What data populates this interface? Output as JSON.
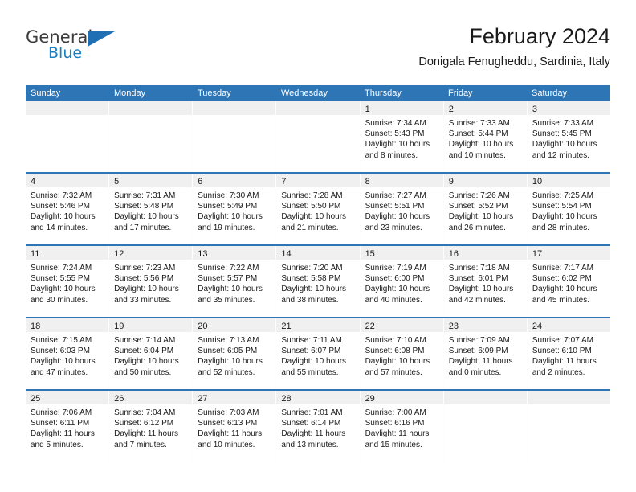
{
  "brand": {
    "name_top": "General",
    "name_bottom": "Blue",
    "flag_icon": "triangle-flag-icon",
    "color_blue": "#1a80c4",
    "color_flag": "#1f6fb4"
  },
  "header": {
    "title": "February 2024",
    "subtitle": "Donigala Fenugheddu, Sardinia, Italy"
  },
  "calendar": {
    "accent_color": "#2e75b6",
    "dateband_color": "#f0f0f0",
    "day_headers": [
      "Sunday",
      "Monday",
      "Tuesday",
      "Wednesday",
      "Thursday",
      "Friday",
      "Saturday"
    ],
    "weeks": [
      [
        {
          "date": "",
          "empty": true,
          "lines": []
        },
        {
          "date": "",
          "empty": true,
          "lines": []
        },
        {
          "date": "",
          "empty": true,
          "lines": []
        },
        {
          "date": "",
          "empty": true,
          "lines": []
        },
        {
          "date": "1",
          "empty": false,
          "lines": [
            "Sunrise: 7:34 AM",
            "Sunset: 5:43 PM",
            "Daylight: 10 hours and 8 minutes."
          ]
        },
        {
          "date": "2",
          "empty": false,
          "lines": [
            "Sunrise: 7:33 AM",
            "Sunset: 5:44 PM",
            "Daylight: 10 hours and 10 minutes."
          ]
        },
        {
          "date": "3",
          "empty": false,
          "lines": [
            "Sunrise: 7:33 AM",
            "Sunset: 5:45 PM",
            "Daylight: 10 hours and 12 minutes."
          ]
        }
      ],
      [
        {
          "date": "4",
          "empty": false,
          "lines": [
            "Sunrise: 7:32 AM",
            "Sunset: 5:46 PM",
            "Daylight: 10 hours and 14 minutes."
          ]
        },
        {
          "date": "5",
          "empty": false,
          "lines": [
            "Sunrise: 7:31 AM",
            "Sunset: 5:48 PM",
            "Daylight: 10 hours and 17 minutes."
          ]
        },
        {
          "date": "6",
          "empty": false,
          "lines": [
            "Sunrise: 7:30 AM",
            "Sunset: 5:49 PM",
            "Daylight: 10 hours and 19 minutes."
          ]
        },
        {
          "date": "7",
          "empty": false,
          "lines": [
            "Sunrise: 7:28 AM",
            "Sunset: 5:50 PM",
            "Daylight: 10 hours and 21 minutes."
          ]
        },
        {
          "date": "8",
          "empty": false,
          "lines": [
            "Sunrise: 7:27 AM",
            "Sunset: 5:51 PM",
            "Daylight: 10 hours and 23 minutes."
          ]
        },
        {
          "date": "9",
          "empty": false,
          "lines": [
            "Sunrise: 7:26 AM",
            "Sunset: 5:52 PM",
            "Daylight: 10 hours and 26 minutes."
          ]
        },
        {
          "date": "10",
          "empty": false,
          "lines": [
            "Sunrise: 7:25 AM",
            "Sunset: 5:54 PM",
            "Daylight: 10 hours and 28 minutes."
          ]
        }
      ],
      [
        {
          "date": "11",
          "empty": false,
          "lines": [
            "Sunrise: 7:24 AM",
            "Sunset: 5:55 PM",
            "Daylight: 10 hours and 30 minutes."
          ]
        },
        {
          "date": "12",
          "empty": false,
          "lines": [
            "Sunrise: 7:23 AM",
            "Sunset: 5:56 PM",
            "Daylight: 10 hours and 33 minutes."
          ]
        },
        {
          "date": "13",
          "empty": false,
          "lines": [
            "Sunrise: 7:22 AM",
            "Sunset: 5:57 PM",
            "Daylight: 10 hours and 35 minutes."
          ]
        },
        {
          "date": "14",
          "empty": false,
          "lines": [
            "Sunrise: 7:20 AM",
            "Sunset: 5:58 PM",
            "Daylight: 10 hours and 38 minutes."
          ]
        },
        {
          "date": "15",
          "empty": false,
          "lines": [
            "Sunrise: 7:19 AM",
            "Sunset: 6:00 PM",
            "Daylight: 10 hours and 40 minutes."
          ]
        },
        {
          "date": "16",
          "empty": false,
          "lines": [
            "Sunrise: 7:18 AM",
            "Sunset: 6:01 PM",
            "Daylight: 10 hours and 42 minutes."
          ]
        },
        {
          "date": "17",
          "empty": false,
          "lines": [
            "Sunrise: 7:17 AM",
            "Sunset: 6:02 PM",
            "Daylight: 10 hours and 45 minutes."
          ]
        }
      ],
      [
        {
          "date": "18",
          "empty": false,
          "lines": [
            "Sunrise: 7:15 AM",
            "Sunset: 6:03 PM",
            "Daylight: 10 hours and 47 minutes."
          ]
        },
        {
          "date": "19",
          "empty": false,
          "lines": [
            "Sunrise: 7:14 AM",
            "Sunset: 6:04 PM",
            "Daylight: 10 hours and 50 minutes."
          ]
        },
        {
          "date": "20",
          "empty": false,
          "lines": [
            "Sunrise: 7:13 AM",
            "Sunset: 6:05 PM",
            "Daylight: 10 hours and 52 minutes."
          ]
        },
        {
          "date": "21",
          "empty": false,
          "lines": [
            "Sunrise: 7:11 AM",
            "Sunset: 6:07 PM",
            "Daylight: 10 hours and 55 minutes."
          ]
        },
        {
          "date": "22",
          "empty": false,
          "lines": [
            "Sunrise: 7:10 AM",
            "Sunset: 6:08 PM",
            "Daylight: 10 hours and 57 minutes."
          ]
        },
        {
          "date": "23",
          "empty": false,
          "lines": [
            "Sunrise: 7:09 AM",
            "Sunset: 6:09 PM",
            "Daylight: 11 hours and 0 minutes."
          ]
        },
        {
          "date": "24",
          "empty": false,
          "lines": [
            "Sunrise: 7:07 AM",
            "Sunset: 6:10 PM",
            "Daylight: 11 hours and 2 minutes."
          ]
        }
      ],
      [
        {
          "date": "25",
          "empty": false,
          "lines": [
            "Sunrise: 7:06 AM",
            "Sunset: 6:11 PM",
            "Daylight: 11 hours and 5 minutes."
          ]
        },
        {
          "date": "26",
          "empty": false,
          "lines": [
            "Sunrise: 7:04 AM",
            "Sunset: 6:12 PM",
            "Daylight: 11 hours and 7 minutes."
          ]
        },
        {
          "date": "27",
          "empty": false,
          "lines": [
            "Sunrise: 7:03 AM",
            "Sunset: 6:13 PM",
            "Daylight: 11 hours and 10 minutes."
          ]
        },
        {
          "date": "28",
          "empty": false,
          "lines": [
            "Sunrise: 7:01 AM",
            "Sunset: 6:14 PM",
            "Daylight: 11 hours and 13 minutes."
          ]
        },
        {
          "date": "29",
          "empty": false,
          "lines": [
            "Sunrise: 7:00 AM",
            "Sunset: 6:16 PM",
            "Daylight: 11 hours and 15 minutes."
          ]
        },
        {
          "date": "",
          "empty": true,
          "lines": []
        },
        {
          "date": "",
          "empty": true,
          "lines": []
        }
      ]
    ]
  }
}
